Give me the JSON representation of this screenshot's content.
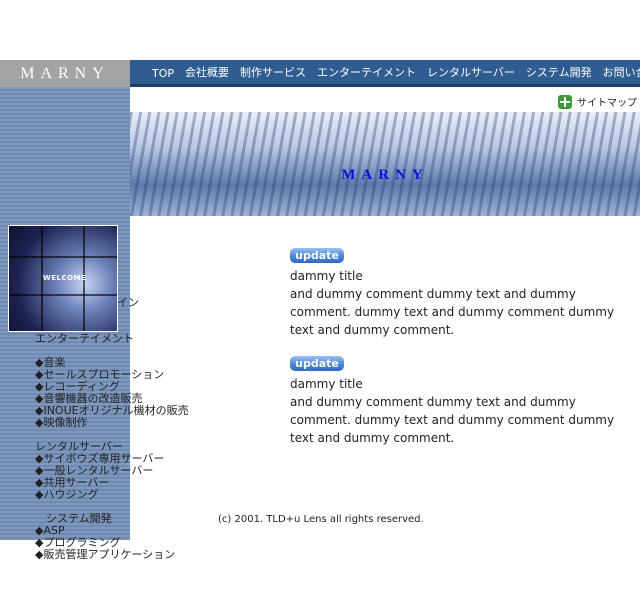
{
  "logo": {
    "text": "MARNY"
  },
  "nav": {
    "items": [
      "TOP",
      "会社概要",
      "制作サービス",
      "エンターテイメント",
      "レンタルサーバー",
      "システム開発",
      "お問い合わせ"
    ]
  },
  "sitemap": {
    "label": "サイトマップ"
  },
  "banner": {
    "title": "MARNY"
  },
  "welcome": {
    "label": "WELCOME",
    "tail": "イン"
  },
  "sidebar": {
    "entertainment_heading": "エンターテイメント",
    "entertainment_items": [
      "◆音楽",
      "◆セールスプロモーション",
      "◆レコーディング",
      "◆音響機器の改造販売",
      "◆INOUEオリジナル機材の販売",
      "◆映像制作"
    ],
    "rental_heading": "レンタルサーバー",
    "rental_items": [
      "◆サイボウズ専用サーバー",
      "◆一般レンタルサーバー",
      "◆共用サーバー",
      "◆ハウジング"
    ],
    "system_heading": "システム開発",
    "system_items": [
      "◆ASP",
      "◆プログラミング",
      "◆販売管理アプリケーション"
    ]
  },
  "news": [
    {
      "badge": "update",
      "title": "dammy title",
      "body": "and dummy comment dummy text and dummy comment. dummy text and dummy  comment dummy text and dummy comment."
    },
    {
      "badge": "update",
      "title": "dammy title",
      "body": "and dummy comment dummy text and dummy comment. dummy text and dummy  comment dummy text and dummy comment."
    }
  ],
  "footer": {
    "copyright": "(c) 2001. TLD+u Lens all rights reserved."
  },
  "colors": {
    "nav_bg": "#2f5d91",
    "logo_bg": "#a3a3a3",
    "sidebar_bg": "#7f98bc",
    "banner_title": "#1010d8"
  }
}
